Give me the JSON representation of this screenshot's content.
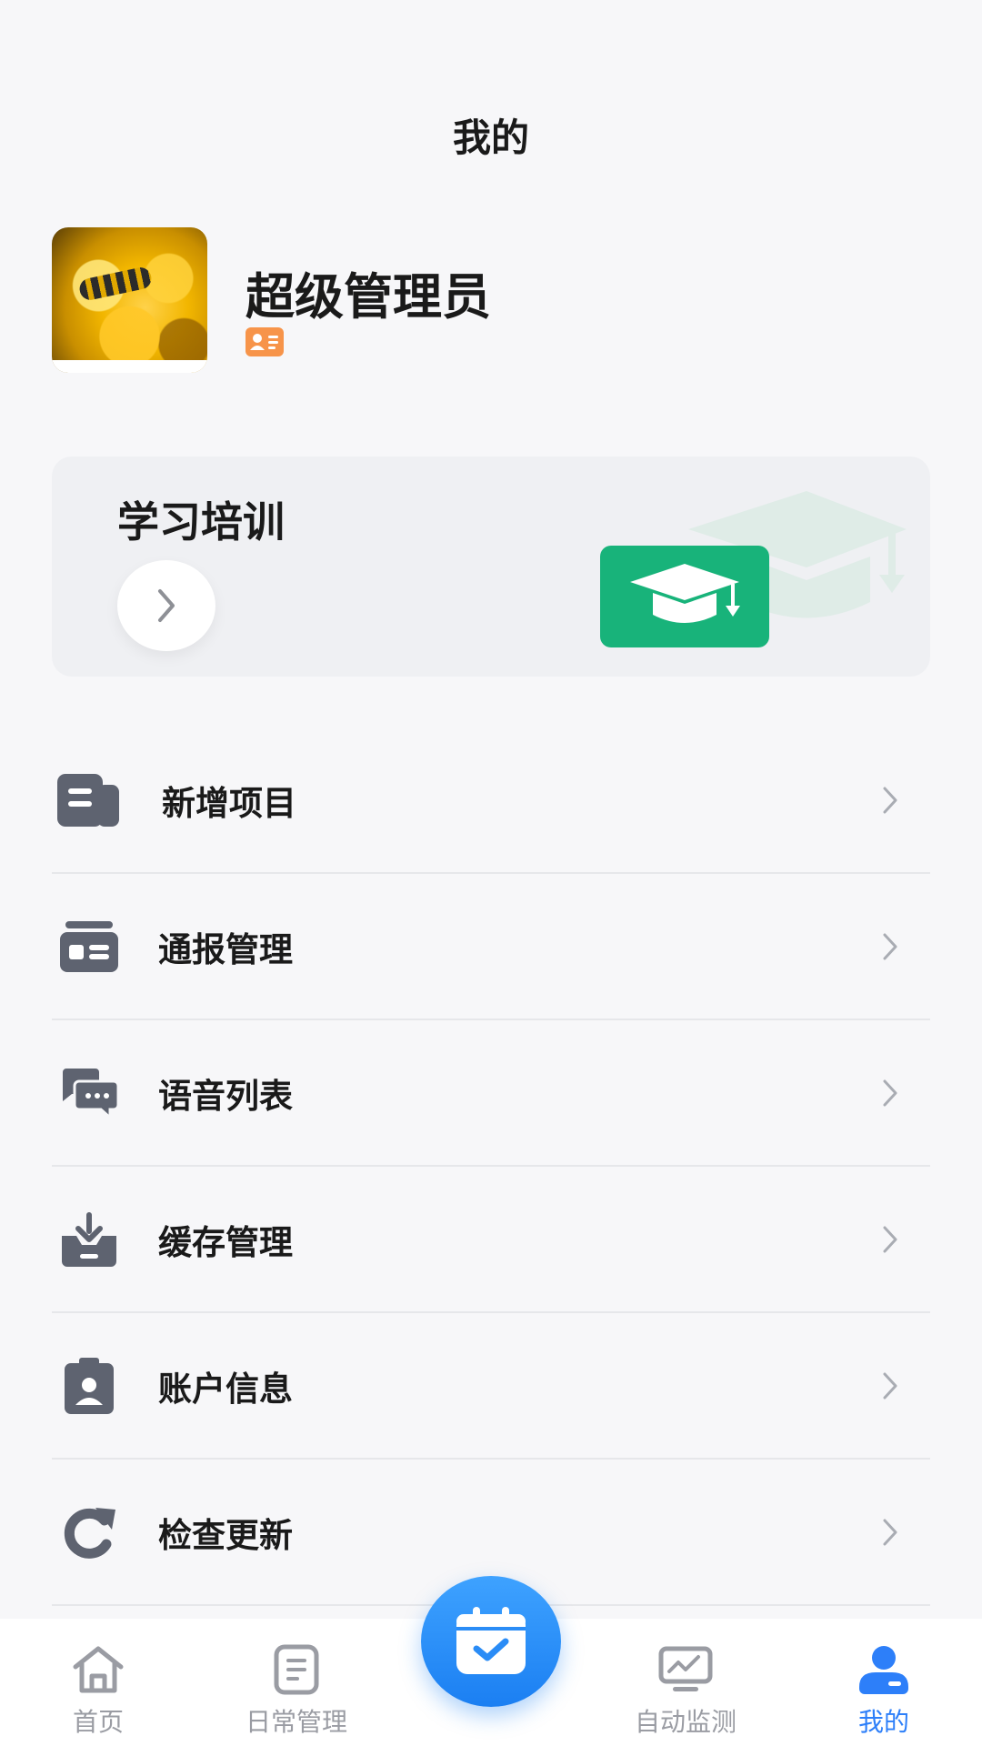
{
  "header": {
    "title": "我的"
  },
  "profile": {
    "name": "超级管理员"
  },
  "training": {
    "title": "学习培训"
  },
  "menu": {
    "items": [
      {
        "label": "新增项目",
        "icon": "project-icon"
      },
      {
        "label": "通报管理",
        "icon": "report-card-icon"
      },
      {
        "label": "语音列表",
        "icon": "chat-bubbles-icon"
      },
      {
        "label": "缓存管理",
        "icon": "download-tray-icon"
      },
      {
        "label": "账户信息",
        "icon": "account-badge-icon"
      },
      {
        "label": "检查更新",
        "icon": "refresh-icon"
      }
    ]
  },
  "tabbar": {
    "tabs": [
      {
        "label": "首页",
        "icon": "home-icon"
      },
      {
        "label": "日常管理",
        "icon": "document-icon"
      },
      {
        "label": "",
        "icon": "calendar-check-icon"
      },
      {
        "label": "自动监测",
        "icon": "monitor-icon"
      },
      {
        "label": "我的",
        "icon": "user-icon",
        "active": true
      }
    ]
  },
  "colors": {
    "accent": "#2d7ff9",
    "training_green": "#18b37a",
    "badge_orange": "#f7944a",
    "icon_gray": "#5e6370"
  }
}
